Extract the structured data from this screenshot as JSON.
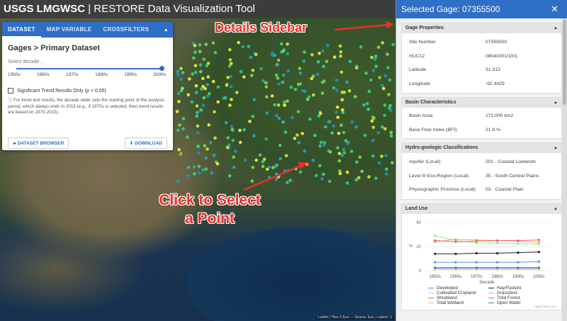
{
  "app": {
    "brand": "USGS LMGWSC",
    "separator": " | ",
    "title": "RESTORE Data Visualization Tool"
  },
  "annotations": {
    "details_sidebar": "Details Sidebar",
    "click_select": "Click to Select a Point",
    "click_select_line1": "Click to Select",
    "click_select_line2": "a Point"
  },
  "panel": {
    "tabs": [
      "DATASET",
      "MAP VARIABLE",
      "CROSSFILTERS"
    ],
    "collapse_icon": "caret-up-icon",
    "title": "Gages > Primary Dataset",
    "decade_label": "Select decade...",
    "slider_value": "2000s",
    "decades": [
      "1950s",
      "1960s",
      "1970s",
      "1980s",
      "1990s",
      "2000s"
    ],
    "trend_checkbox": "Significant Trend Results Only (p < 0.05)",
    "note": "For trend test results, the decade slider sets the starting point of the analysis period, which always ends in 2015 (e.g., if 1970s is selected, then trend results are based on 1970-2015).",
    "dataset_browser_btn": "DATASET BROWSER",
    "download_btn": "DOWNLOAD"
  },
  "sidebar": {
    "title": "Selected Gage: 07355500",
    "gage_properties": {
      "header": "Gage Properties",
      "rows": [
        {
          "k": "Site Number",
          "v": "07355500"
        },
        {
          "k": "HUC12",
          "v": "080403010201"
        },
        {
          "k": "Latitude",
          "v": "31.313"
        },
        {
          "k": "Longitude",
          "v": "-92.4429"
        }
      ]
    },
    "basin": {
      "header": "Basin Characteristics",
      "rows": [
        {
          "k": "Basin Area:",
          "v": "172,000 km2"
        },
        {
          "k": "Base Flow Index (BFI):",
          "v": "21.6 %"
        }
      ]
    },
    "hydro": {
      "header": "Hydro-geologic Classifications",
      "rows": [
        {
          "k": "Aquifer (Local):",
          "v": "201 - Coastal Lowlands"
        },
        {
          "k": "Level III Eco-Region (Local):",
          "v": "35 - South Central Plains"
        },
        {
          "k": "Physiographic Province (Local):",
          "v": "03 - Coastal Plain"
        }
      ]
    },
    "landuse": {
      "header": "Land Use"
    }
  },
  "chart_data": {
    "type": "line",
    "title": "",
    "xlabel": "Decade",
    "ylabel": "%",
    "ylim": [
      0,
      40
    ],
    "yticks": [
      0,
      20,
      40
    ],
    "categories": [
      "1950s",
      "1960s",
      "1970s",
      "1980s",
      "1990s",
      "2000s"
    ],
    "series": [
      {
        "name": "Developed",
        "color": "#5b8ff9",
        "values": [
          7,
          7,
          7,
          7,
          7,
          7.5
        ]
      },
      {
        "name": "Hay/Pasture",
        "color": "#222222",
        "values": [
          14,
          14,
          14.5,
          14.5,
          15,
          15.5
        ]
      },
      {
        "name": "Cultivated Cropland",
        "color": "#90ed7d",
        "values": [
          29,
          25,
          23,
          23,
          22.5,
          22
        ]
      },
      {
        "name": "Grassland",
        "color": "#f7a35c",
        "values": [
          24,
          26,
          25.5,
          25,
          24.5,
          23.5
        ]
      },
      {
        "name": "Shrubland",
        "color": "#8085e9",
        "values": [
          2,
          2,
          2,
          2,
          2,
          2
        ]
      },
      {
        "name": "Total Forest",
        "color": "#f15c80",
        "values": [
          25,
          24,
          24.5,
          25,
          25,
          25.5
        ]
      },
      {
        "name": "Total Wetland",
        "color": "#e4d354",
        "values": [
          1,
          1,
          1,
          1,
          1,
          1
        ]
      },
      {
        "name": "Open Water",
        "color": "#2b908f",
        "values": [
          2.5,
          2.5,
          2.5,
          2.5,
          2.5,
          2.5
        ]
      }
    ],
    "credit": "Highcharts.com"
  },
  "map": {
    "attribution": "Leaflet | Tiles © Esri — Source: Esri, i-cubed, U"
  }
}
